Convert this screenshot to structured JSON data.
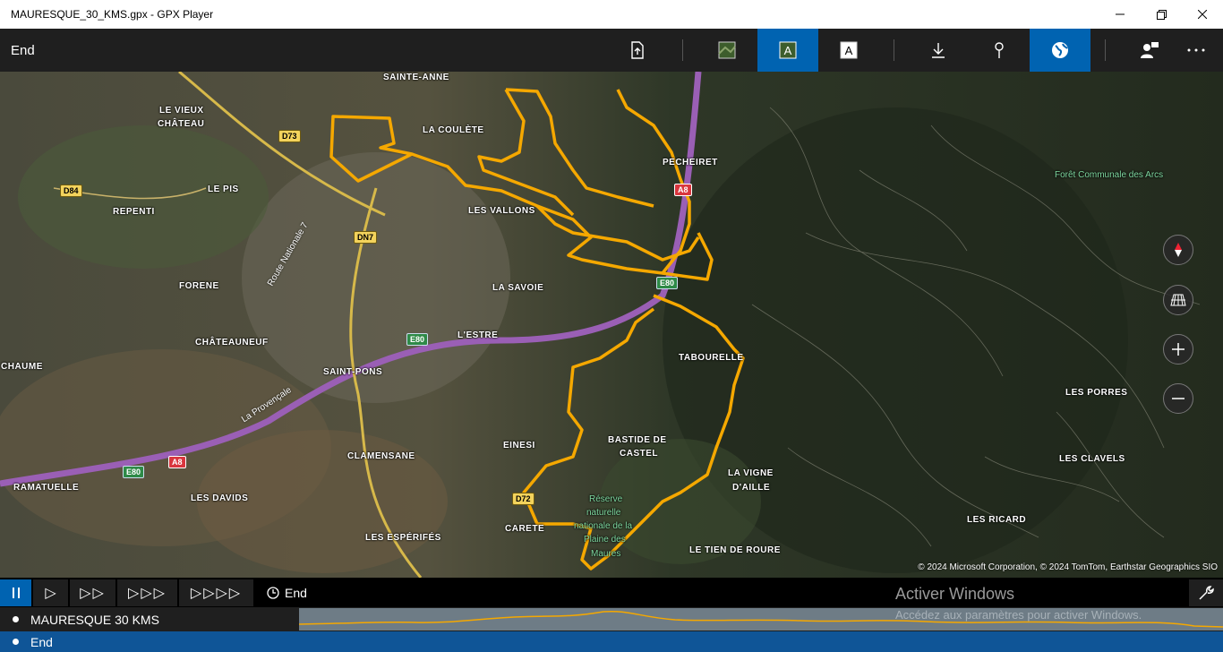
{
  "window": {
    "title": "MAURESQUE_30_KMS.gpx - GPX Player",
    "minimize_icon": "minimize-icon",
    "maximize_icon": "restore-icon",
    "close_icon": "close-icon"
  },
  "toolbar": {
    "title": "End",
    "buttons": [
      {
        "icon": "export-file-icon",
        "active": false
      },
      {
        "icon": "aerial-map-icon",
        "active": false
      },
      {
        "icon": "aerial-labels-icon",
        "active": true
      },
      {
        "icon": "road-labels-icon",
        "active": false
      },
      {
        "icon": "download-icon",
        "active": false
      },
      {
        "icon": "pin-icon",
        "active": false
      },
      {
        "icon": "globe-icon",
        "active": true
      },
      {
        "icon": "people-icon",
        "active": false
      },
      {
        "icon": "more-icon",
        "active": false
      }
    ],
    "accent": "#0063b1"
  },
  "map": {
    "places": [
      {
        "label": "SAINTE-ANNE"
      },
      {
        "label": "LE VIEUX"
      },
      {
        "label": "CHÂTEAU"
      },
      {
        "label": "LA COULÈTE"
      },
      {
        "label": "PECHEIRET"
      },
      {
        "label": "LE PIS"
      },
      {
        "label": "REPENTI"
      },
      {
        "label": "LES VALLONS"
      },
      {
        "label": "FORENE"
      },
      {
        "label": "LA SAVOIE"
      },
      {
        "label": "CHÂTEAUNEUF"
      },
      {
        "label": "L'ESTRE"
      },
      {
        "label": "CHAUME"
      },
      {
        "label": "SAINT-PONS"
      },
      {
        "label": "TABOURELLE"
      },
      {
        "label": "LES PORRES"
      },
      {
        "label": "EINESI"
      },
      {
        "label": "BASTIDE DE"
      },
      {
        "label": "CASTEL"
      },
      {
        "label": "CLAMENSANE"
      },
      {
        "label": "LES CLAVELS"
      },
      {
        "label": "LA VIGNE"
      },
      {
        "label": "D'AILLE"
      },
      {
        "label": "RAMATUELLE"
      },
      {
        "label": "LES DAVIDS"
      },
      {
        "label": "LES RICARD"
      },
      {
        "label": "CARETE"
      },
      {
        "label": "LES ESPÉRIFÉS"
      },
      {
        "label": "LE TIEN DE ROURE"
      }
    ],
    "green_labels": [
      {
        "label": "Forêt Communale des Arcs"
      },
      {
        "label": "Réserve"
      },
      {
        "label": "naturelle"
      },
      {
        "label": "nationale de la"
      },
      {
        "label": "Plaine des"
      },
      {
        "label": "Maures"
      }
    ],
    "shields": [
      {
        "label": "D73",
        "color": "yellow"
      },
      {
        "label": "D84",
        "color": "yellow"
      },
      {
        "label": "DN7",
        "color": "yellow"
      },
      {
        "label": "A8",
        "color": "red"
      },
      {
        "label": "E80",
        "color": "green"
      },
      {
        "label": "E80",
        "color": "green"
      },
      {
        "label": "E80",
        "color": "green"
      },
      {
        "label": "A8",
        "color": "red"
      },
      {
        "label": "D72",
        "color": "yellow"
      }
    ],
    "road_names": [
      {
        "label": "Route Nationale 7"
      },
      {
        "label": "La Provençale"
      }
    ],
    "controls": [
      "compass-icon",
      "3d-view-icon",
      "zoom-in-icon",
      "zoom-out-icon"
    ],
    "copyright": "© 2024 Microsoft Corporation, © 2024 TomTom, Earthstar Geographics  SIO",
    "track_color": "#f5a800"
  },
  "playback": {
    "pause_icon": "pause-icon",
    "speed_buttons": [
      {
        "icon": "play-1x-icon",
        "glyph": "▷"
      },
      {
        "icon": "play-2x-icon",
        "glyph": "▷▷"
      },
      {
        "icon": "play-3x-icon",
        "glyph": "▷▷▷"
      },
      {
        "icon": "play-4x-icon",
        "glyph": "▷▷▷▷"
      }
    ],
    "position_label": "End",
    "clock_icon": "clock-icon",
    "activate_title": "Activer Windows",
    "settings_icon": "wrench-icon"
  },
  "track": {
    "name": "MAURESQUE 30 KMS",
    "activate_subtitle": "Accédez aux paramètres pour activer Windows."
  },
  "status": {
    "label": "End"
  }
}
